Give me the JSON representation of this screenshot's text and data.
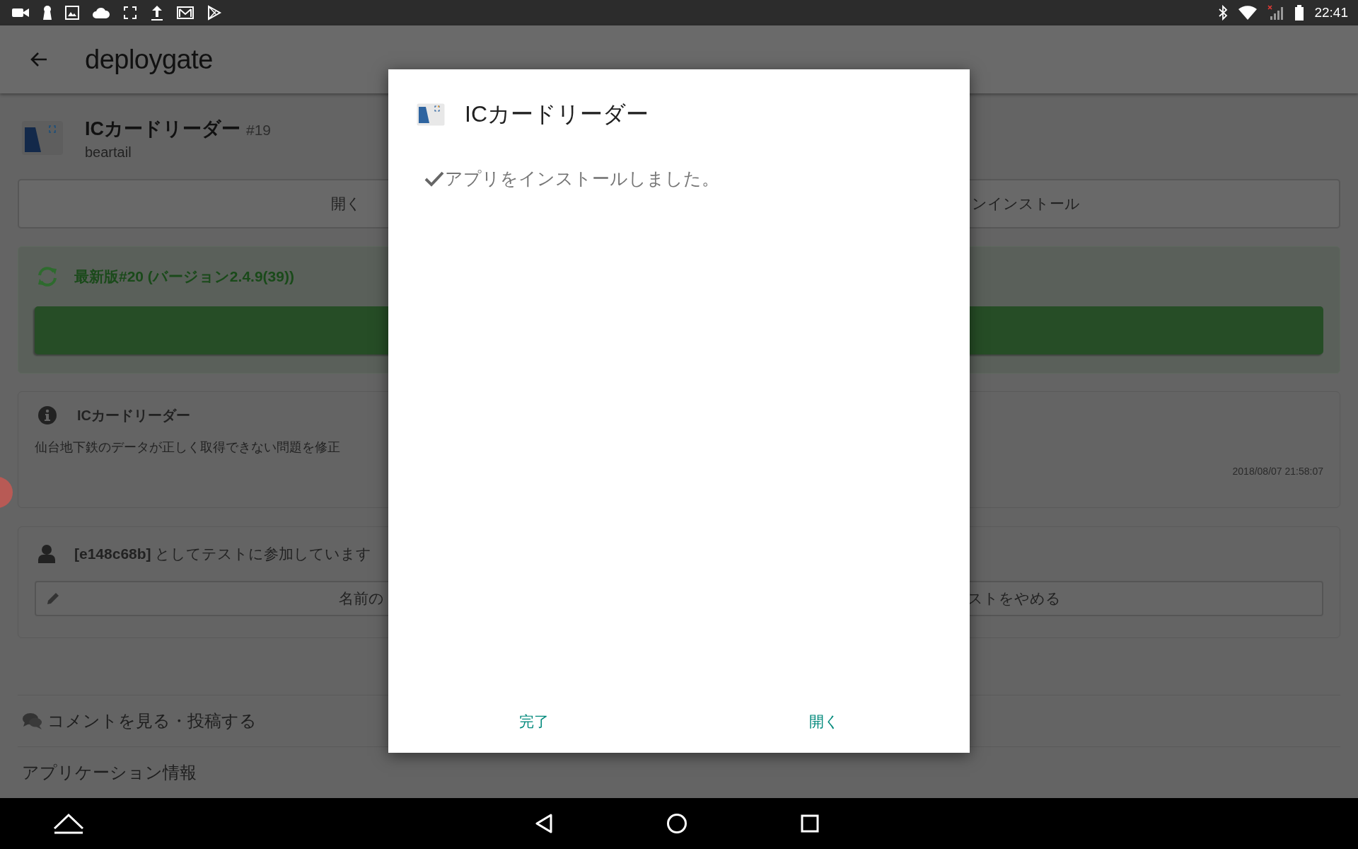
{
  "status_bar": {
    "time": "22:41"
  },
  "app_bar": {
    "logo": "deploy**gate**"
  },
  "app": {
    "name": "ICカードリーダー",
    "build": "#19",
    "owner": "beartail"
  },
  "action_buttons": [
    "開く",
    "ンインストール"
  ],
  "update_panel": {
    "label": "最新版#20 (バージョン2.4.9(39))"
  },
  "info_card": {
    "title": "ICカードリーダー",
    "description": "仙台地下鉄のデータが正しく取得できない問題を修正",
    "timestamp": "2018/08/07 21:58:07"
  },
  "tester_card": {
    "text": "**[e148c68b]** としてテストに参加しています",
    "buttons": [
      "名前の",
      "ストをやめる"
    ]
  },
  "links": [
    {
      "kind": "comments",
      "label": "コメントを見る・投稿する"
    },
    {
      "kind": "plain",
      "label": "アプリケーション情報"
    }
  ],
  "dialog": {
    "title": "ICカードリーダー",
    "message": "アプリをインストールしました。",
    "buttons": [
      "完了",
      "開く"
    ]
  }
}
